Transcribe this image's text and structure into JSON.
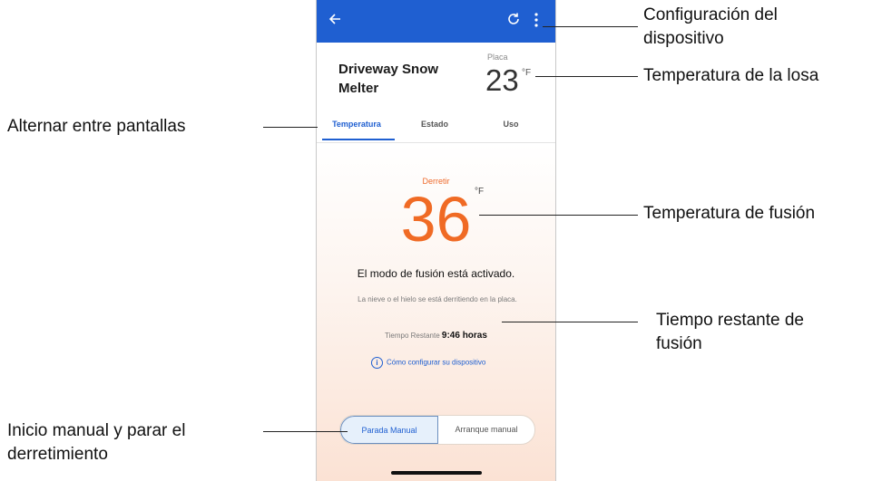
{
  "app": {
    "device_name": "Driveway Snow Melter",
    "slab": {
      "label": "Placa",
      "value": "23",
      "unit": "°F"
    },
    "tabs": [
      {
        "label": "Temperatura",
        "active": true
      },
      {
        "label": "Estado",
        "active": false
      },
      {
        "label": "Uso",
        "active": false
      }
    ],
    "melt": {
      "label": "Derretir",
      "value": "36",
      "unit": "°F"
    },
    "mode_title": "El modo de fusión está activado.",
    "mode_description": "La nieve o el hielo se está derritiendo en la placa.",
    "remaining": {
      "label": "Tiempo Restante",
      "value": "9:46 horas"
    },
    "config_link": "Cómo configurar su dispositivo",
    "buttons": {
      "stop": "Parada Manual",
      "start": "Arranque manual"
    },
    "colors": {
      "appbar": "#1f5fd1",
      "accent": "#f06a24"
    }
  },
  "annotations": {
    "settings": "Configuración del dispositivo",
    "slab_temp": "Temperatura de la losa",
    "toggle_screens": "Alternar entre pantallas",
    "melt_temp": "Temperatura de fusión",
    "remaining_time": "Tiempo restante de fusión",
    "manual": "Inicio manual y parar el derretimiento"
  }
}
